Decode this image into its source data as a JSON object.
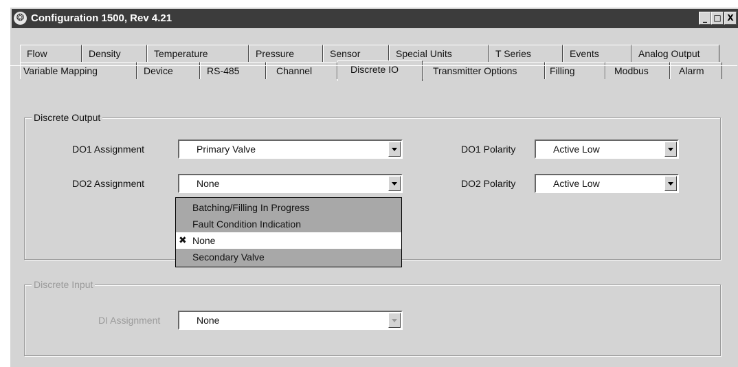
{
  "window": {
    "title": "Configuration 1500, Rev 4.21",
    "minimize_glyph": "_",
    "maximize_glyph": "□",
    "close_glyph": "X"
  },
  "tabs": {
    "row1": [
      "Flow",
      "Density",
      "Temperature",
      "Pressure",
      "Sensor",
      "Special Units",
      "T Series",
      "Events",
      "Analog Output"
    ],
    "row2": [
      "Variable Mapping",
      "Device",
      "RS-485",
      "Channel",
      "Discrete IO",
      "Transmitter Options",
      "Filling",
      "Modbus",
      "Alarm"
    ],
    "active": "Discrete IO"
  },
  "discrete_output": {
    "group_label": "Discrete Output",
    "do1_assignment_label": "DO1 Assignment",
    "do1_assignment_value": "Primary Valve",
    "do2_assignment_label": "DO2 Assignment",
    "do2_assignment_value": "None",
    "do1_polarity_label": "DO1 Polarity",
    "do1_polarity_value": "Active Low",
    "do2_polarity_label": "DO2 Polarity",
    "do2_polarity_value": "Active Low"
  },
  "do2_dropdown": {
    "options": [
      "Batching/Filling In Progress",
      "Fault Condition Indication",
      "None",
      "Secondary Valve"
    ],
    "selected": "None",
    "check_glyph": "✖"
  },
  "discrete_input": {
    "group_label": "Discrete Input",
    "di_assignment_label": "DI Assignment",
    "di_assignment_value": "None"
  }
}
